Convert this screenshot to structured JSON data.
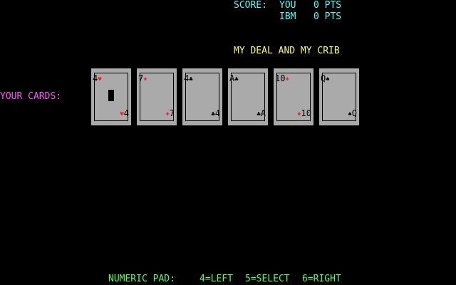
{
  "score": {
    "label": "SCORE:",
    "rows": [
      {
        "name": "YOU",
        "value": "0 PTS"
      },
      {
        "name": "IBM",
        "value": "0 PTS"
      }
    ]
  },
  "status": "MY DEAL AND MY CRIB",
  "hand_label": "YOUR CARDS:",
  "cards": [
    {
      "rank": "4",
      "suit": "♥",
      "suit_color": "red"
    },
    {
      "rank": "7",
      "suit": "♦",
      "suit_color": "red"
    },
    {
      "rank": "4",
      "suit": "♣",
      "suit_color": "black"
    },
    {
      "rank": "A",
      "suit": "♣",
      "suit_color": "black"
    },
    {
      "rank": "10",
      "suit": "♦",
      "suit_color": "red"
    },
    {
      "rank": "Q",
      "suit": "♠",
      "suit_color": "black"
    }
  ],
  "footer": {
    "label": "NUMERIC PAD:",
    "left": "4=LEFT",
    "select": "5=SELECT",
    "right": "6=RIGHT"
  },
  "colors": {
    "suit_red": "#ff2020",
    "card_bg": "#aaaaaa"
  }
}
